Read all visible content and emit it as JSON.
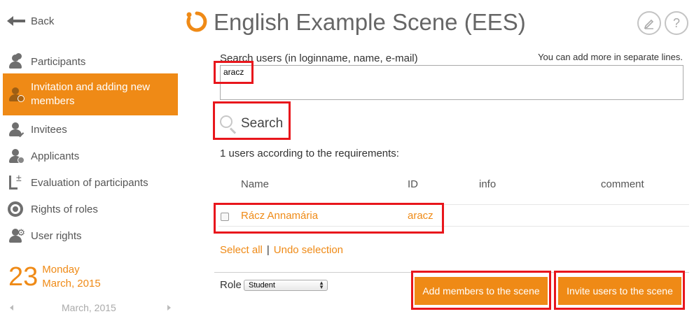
{
  "nav": {
    "back_label": "Back",
    "items": [
      {
        "label": "Participants"
      },
      {
        "label": "Invitation and adding new members"
      },
      {
        "label": "Invitees"
      },
      {
        "label": "Applicants"
      },
      {
        "label": "Evaluation of participants"
      },
      {
        "label": "Rights of roles"
      },
      {
        "label": "User rights"
      }
    ]
  },
  "calendar": {
    "day": "23",
    "weekday": "Monday",
    "month_year": "March, 2015",
    "nav_month": "March, 2015"
  },
  "header": {
    "title": "English Example Scene (EES)",
    "edit_icon": "pencil-icon",
    "help_label": "?"
  },
  "search": {
    "label": "Search users (in loginname, name, e-mail)",
    "hint": "You can add more in separate lines.",
    "value": "aracz",
    "button_label": "Search"
  },
  "results": {
    "count_text": "1 users according to the requirements:",
    "columns": [
      "Name",
      "ID",
      "info",
      "comment"
    ],
    "rows": [
      {
        "name": "Rácz Annamária",
        "id": "aracz",
        "info": "",
        "comment": ""
      }
    ]
  },
  "selection": {
    "select_all": "Select all",
    "separator": "|",
    "undo": "Undo selection"
  },
  "footer": {
    "role_label": "Role",
    "role_value": "Student",
    "add_button": "Add members to the scene",
    "invite_button": "Invite users to the scene"
  },
  "colors": {
    "accent": "#ef8a16",
    "highlight": "#e8161c",
    "text": "#555555"
  }
}
